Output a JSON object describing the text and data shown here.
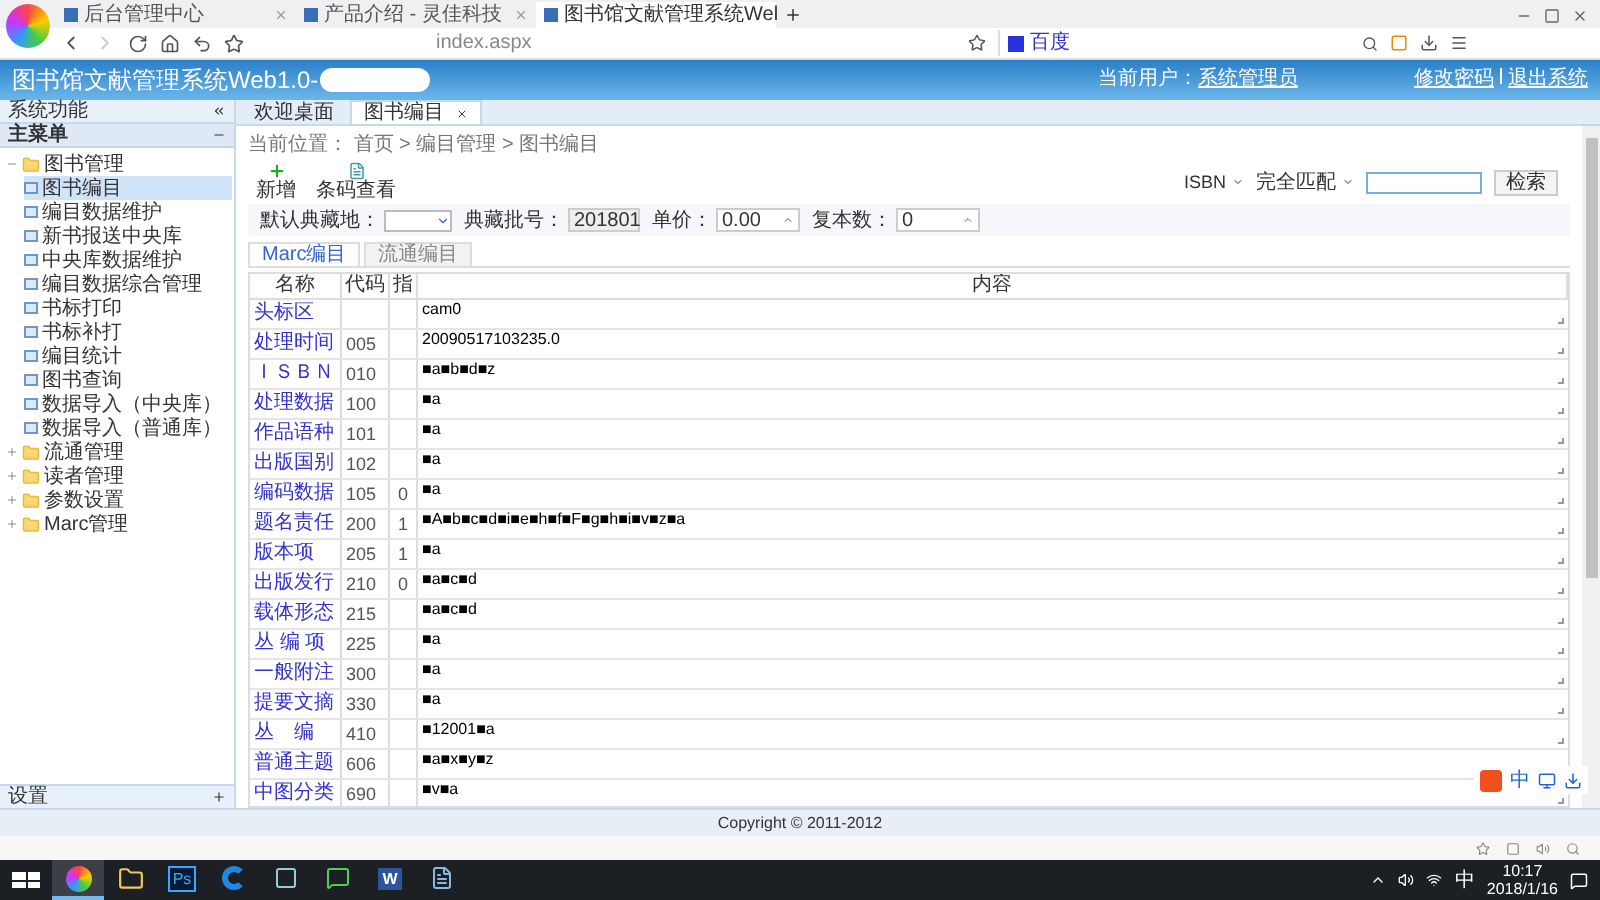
{
  "browser": {
    "tabs": [
      {
        "label": "后台管理中心",
        "selected": false
      },
      {
        "label": "产品介绍 - 灵佳科技",
        "selected": false
      },
      {
        "label": "图书馆文献管理系统Wel",
        "selected": true
      }
    ],
    "address": "index.aspx",
    "search_placeholder": "百度"
  },
  "header": {
    "title": "图书馆文献管理系统Web1.0-",
    "user_label": "当前用户：",
    "user": "系统管理员",
    "links": [
      "修改密码",
      "退出系统"
    ]
  },
  "sidebar": {
    "title": "系统功能",
    "section": "主菜单",
    "footer": "设置",
    "tree": [
      {
        "label": "图书管理",
        "expanded": true,
        "children": [
          {
            "label": "图书编目",
            "selected": true
          },
          {
            "label": "编目数据维护",
            "selected": false
          },
          {
            "label": "新书报送中央库",
            "selected": false
          },
          {
            "label": "中央库数据维护",
            "selected": false
          },
          {
            "label": "编目数据综合管理",
            "selected": false
          },
          {
            "label": "书标打印",
            "selected": false
          },
          {
            "label": "书标补打",
            "selected": false
          },
          {
            "label": "编目统计",
            "selected": false
          },
          {
            "label": "图书查询",
            "selected": false
          },
          {
            "label": "数据导入（中央库）",
            "selected": false
          },
          {
            "label": "数据导入（普通库）",
            "selected": false
          }
        ]
      },
      {
        "label": "流通管理",
        "expanded": false
      },
      {
        "label": "读者管理",
        "expanded": false
      },
      {
        "label": "参数设置",
        "expanded": false
      },
      {
        "label": "Marc管理",
        "expanded": false
      }
    ]
  },
  "content_tabs": [
    {
      "label": "欢迎桌面",
      "selected": false,
      "closable": false
    },
    {
      "label": "图书编目",
      "selected": true,
      "closable": true
    }
  ],
  "breadcrumb": "当前位置： 首页 > 编目管理 > 图书编目",
  "toolbar": [
    {
      "label": "新增",
      "kind": "add"
    },
    {
      "label": "条码查看",
      "kind": "barcode"
    }
  ],
  "filters": [
    {
      "label": "默认典藏地：",
      "kind": "select"
    },
    {
      "label": "典藏批号：",
      "kind": "text",
      "value": "201801"
    },
    {
      "label": "单价：",
      "kind": "spin",
      "value": "0.00"
    },
    {
      "label": "复本数：",
      "kind": "spin",
      "value": "0"
    }
  ],
  "search": {
    "field": "ISBN",
    "match": "完全匹配",
    "button": "检索"
  },
  "subtabs": [
    {
      "label": "Marc编目",
      "selected": true
    },
    {
      "label": "流通编目",
      "selected": false
    }
  ],
  "table": {
    "columns": [
      "名称",
      "代码",
      "指",
      "内容"
    ],
    "rows": [
      {
        "name": "头标区",
        "code": "",
        "indicator": "",
        "content": "cam0"
      },
      {
        "name": "处理时间",
        "code": "005",
        "indicator": "",
        "content": "20090517103235.0"
      },
      {
        "name": "ＩＳＢＮ",
        "code": "010",
        "indicator": "",
        "content": "■a■b■d■z"
      },
      {
        "name": "处理数据",
        "code": "100",
        "indicator": "",
        "content": "■a"
      },
      {
        "name": "作品语种",
        "code": "101",
        "indicator": "",
        "content": "■a"
      },
      {
        "name": "出版国别",
        "code": "102",
        "indicator": "",
        "content": "■a"
      },
      {
        "name": "编码数据",
        "code": "105",
        "indicator": "0",
        "content": "■a"
      },
      {
        "name": "题名责任",
        "code": "200",
        "indicator": "1",
        "content": "■A■b■c■d■i■e■h■f■F■g■h■i■v■z■a"
      },
      {
        "name": "版本项",
        "code": "205",
        "indicator": "1",
        "content": "■a"
      },
      {
        "name": "出版发行",
        "code": "210",
        "indicator": "0",
        "content": "■a■c■d"
      },
      {
        "name": "载体形态",
        "code": "215",
        "indicator": "",
        "content": "■a■c■d"
      },
      {
        "name": "丛 编 项",
        "code": "225",
        "indicator": "",
        "content": "■a"
      },
      {
        "name": "一般附注",
        "code": "300",
        "indicator": "",
        "content": "■a"
      },
      {
        "name": "提要文摘",
        "code": "330",
        "indicator": "",
        "content": "■a"
      },
      {
        "name": "丛　编",
        "code": "410",
        "indicator": "",
        "content": "■12001■a"
      },
      {
        "name": "普通主题",
        "code": "606",
        "indicator": "",
        "content": "■a■x■y■z"
      },
      {
        "name": "中图分类",
        "code": "690",
        "indicator": "",
        "content": "■v■a"
      }
    ]
  },
  "footer": "Copyright © 2011-2012",
  "ime": {
    "label": "中"
  },
  "taskbar": {
    "apps": [
      {
        "kind": "browser",
        "selected": true
      },
      {
        "kind": "folder",
        "selected": false
      },
      {
        "kind": "ps",
        "label": "Ps",
        "selected": false
      },
      {
        "kind": "edge",
        "selected": false
      },
      {
        "kind": "box",
        "selected": false
      },
      {
        "kind": "chat",
        "selected": false
      },
      {
        "kind": "word",
        "label": "W",
        "selected": false
      },
      {
        "kind": "notepad",
        "selected": false
      }
    ],
    "ime": "中",
    "time": "10:17",
    "date": "2018/1/16"
  }
}
